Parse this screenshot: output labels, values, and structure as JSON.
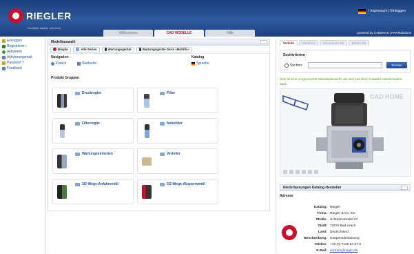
{
  "header": {
    "brand": "RIEGLER",
    "tagline": "Druckluft, sauber und mehr",
    "top_links": "|  Impressum  |  Einloggen",
    "tabs": [
      {
        "label": "Willkommen",
        "active": false
      },
      {
        "label": "CAD MODELLE",
        "active": true
      },
      {
        "label": "Hilfe",
        "active": false
      }
    ],
    "powered": "powered by CADENAS | PARTsolutions"
  },
  "sidebar": {
    "items": [
      {
        "label": "Einloggen",
        "icon": "key-icon",
        "color": "#d4a017"
      },
      {
        "label": "Registrieren",
        "icon": "pencil-icon",
        "color": "#3a7d2c"
      },
      {
        "label": "Aktivieren",
        "icon": "check-icon",
        "color": "#2e9e3a"
      },
      {
        "label": "Aktivierungsmail",
        "icon": "mail-icon",
        "color": "#5c7fb8"
      },
      {
        "label": "Passwort ?",
        "icon": "key-icon",
        "color": "#d4a017"
      },
      {
        "label": "Feedback",
        "icon": "feedback-icon",
        "color": "#5c7fb8"
      }
    ]
  },
  "center": {
    "title": "Modellauswahl",
    "crumbs": [
      "Riegler",
      "Alle Serien",
      "Wartungsgeräte",
      "Wartungsgeräte Serie »Multifix«"
    ],
    "navigation_label": "Navigation",
    "back": "Zurück",
    "home": "Startseite",
    "catalog_label": "Katalog",
    "language": "Sprache",
    "groups_label": "Produkt Gruppen",
    "products": [
      {
        "name": "Druckregler"
      },
      {
        "name": "Filter"
      },
      {
        "name": "Filterregler"
      },
      {
        "name": "Nebelöler"
      },
      {
        "name": "Wartungseinheiten"
      },
      {
        "name": "Verteiler"
      },
      {
        "name": "3/2-Wege-Anfahrventil"
      },
      {
        "name": "3/2-Wege-Absperrventil"
      }
    ]
  },
  "right": {
    "tabs": [
      {
        "label": "Vollbild",
        "active": true
      },
      {
        "label": "Variables",
        "active": false
      },
      {
        "label": "Generieren 3D",
        "active": false
      },
      {
        "label": "Bauen 3D",
        "active": false
      }
    ],
    "search_title": "Suchkriterien",
    "search_label": "Suchen:",
    "search_value": "",
    "search_button": "Suchen",
    "hint": "Dies ist eine vorgenerierte Standardansicht, die sich von Ihrer Auswahl unterscheiden kann.",
    "watermark": "CAD HOME",
    "info_title": "Niederlassungen Katalog Hersteller",
    "adresse_label": "Adresse",
    "info": [
      {
        "k": "Katalog:",
        "v": "Riegler"
      },
      {
        "k": "Firma:",
        "v": "Riegler & Co. KG"
      },
      {
        "k": "Straße:",
        "v": "Schützenstraße 27"
      },
      {
        "k": "Stadt:",
        "v": "72574 Bad Urach"
      },
      {
        "k": "Land:",
        "v": "Deutschland"
      },
      {
        "k": "Beschreibung:",
        "v": "Hauptniederlassung"
      },
      {
        "k": "Telefon:",
        "v": "+49 (0) 7125 94 97-0"
      },
      {
        "k": "E-Mail:",
        "v": "vertrieb@riegler.de",
        "link": true
      }
    ]
  }
}
